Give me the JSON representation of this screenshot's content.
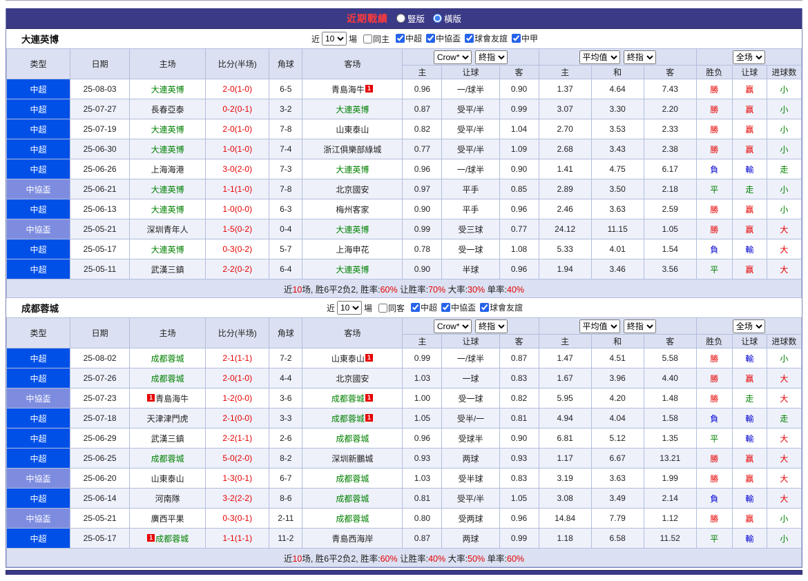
{
  "top_bar": {
    "title": "近期戰績",
    "radios": [
      {
        "label": "豎版",
        "selected": false
      },
      {
        "label": "橫版",
        "selected": true
      }
    ]
  },
  "badge_text": "1",
  "table": {
    "left_columns": [
      "类型",
      "日期",
      "主场",
      "比分(半场)",
      "角球",
      "客场"
    ],
    "odds_group": {
      "select1": "Crow*",
      "select2": "終指",
      "cols": [
        "主",
        "让球",
        "客"
      ]
    },
    "avg_group": {
      "select1": "平均值",
      "select2": "終指",
      "cols": [
        "主",
        "和",
        "客"
      ]
    },
    "result_group": {
      "select1": "全场",
      "cols": [
        "胜负",
        "让球",
        "进球数"
      ]
    }
  },
  "sections": [
    {
      "team": "大連英博",
      "filters": {
        "prefix": "近",
        "count": "10",
        "suffix": "場",
        "same_venue": {
          "label": "同主",
          "checked": false
        },
        "leagues": [
          {
            "label": "中超",
            "checked": true
          },
          {
            "label": "中協盃",
            "checked": true
          },
          {
            "label": "球會友誼",
            "checked": true
          },
          {
            "label": "中甲",
            "checked": true
          }
        ]
      },
      "rows": [
        {
          "league": "中超",
          "date": "25-08-03",
          "home": "大連英博",
          "home_green": true,
          "home_badge": "",
          "score": "2-0(1-0)",
          "corner": "6-5",
          "away": "青島海牛",
          "away_green": false,
          "away_badge": "post",
          "odds": [
            "0.96",
            "一/球半",
            "0.90"
          ],
          "avg": [
            "1.37",
            "4.64",
            "7.43"
          ],
          "results": [
            "勝",
            "赢",
            "小"
          ]
        },
        {
          "league": "中超",
          "date": "25-07-27",
          "home": "長春亞泰",
          "home_green": false,
          "home_badge": "",
          "score": "0-2(0-1)",
          "corner": "3-2",
          "away": "大連英博",
          "away_green": true,
          "away_badge": "",
          "odds": [
            "0.87",
            "受平/半",
            "0.99"
          ],
          "avg": [
            "3.07",
            "3.30",
            "2.20"
          ],
          "results": [
            "勝",
            "赢",
            "小"
          ]
        },
        {
          "league": "中超",
          "date": "25-07-19",
          "home": "大連英博",
          "home_green": true,
          "home_badge": "",
          "score": "2-0(1-0)",
          "corner": "7-8",
          "away": "山東泰山",
          "away_green": false,
          "away_badge": "",
          "odds": [
            "0.82",
            "受平/半",
            "1.04"
          ],
          "avg": [
            "2.70",
            "3.53",
            "2.33"
          ],
          "results": [
            "勝",
            "赢",
            "小"
          ]
        },
        {
          "league": "中超",
          "date": "25-06-30",
          "home": "大連英博",
          "home_green": true,
          "home_badge": "",
          "score": "1-0(1-0)",
          "corner": "7-4",
          "away": "浙江俱樂部綠城",
          "away_green": false,
          "away_badge": "",
          "odds": [
            "0.77",
            "受平/半",
            "1.09"
          ],
          "avg": [
            "2.68",
            "3.43",
            "2.38"
          ],
          "results": [
            "勝",
            "赢",
            "小"
          ]
        },
        {
          "league": "中超",
          "date": "25-06-26",
          "home": "上海海港",
          "home_green": false,
          "home_badge": "",
          "score": "3-0(2-0)",
          "corner": "7-3",
          "away": "大連英博",
          "away_green": true,
          "away_badge": "",
          "odds": [
            "0.96",
            "一/球半",
            "0.90"
          ],
          "avg": [
            "1.41",
            "4.75",
            "6.17"
          ],
          "results": [
            "負",
            "輸",
            "走"
          ]
        },
        {
          "league": "中協盃",
          "date": "25-06-21",
          "home": "大連英博",
          "home_green": true,
          "home_badge": "",
          "score": "1-1(1-0)",
          "corner": "7-8",
          "away": "北京國安",
          "away_green": false,
          "away_badge": "",
          "odds": [
            "0.97",
            "平手",
            "0.85"
          ],
          "avg": [
            "2.89",
            "3.50",
            "2.18"
          ],
          "results": [
            "平",
            "走",
            "小"
          ]
        },
        {
          "league": "中超",
          "date": "25-06-13",
          "home": "大連英博",
          "home_green": true,
          "home_badge": "",
          "score": "1-0(0-0)",
          "corner": "6-3",
          "away": "梅州客家",
          "away_green": false,
          "away_badge": "",
          "odds": [
            "0.90",
            "平手",
            "0.96"
          ],
          "avg": [
            "2.46",
            "3.63",
            "2.59"
          ],
          "results": [
            "勝",
            "赢",
            "小"
          ]
        },
        {
          "league": "中協盃",
          "date": "25-05-21",
          "home": "深圳青年人",
          "home_green": false,
          "home_badge": "",
          "score": "1-5(0-2)",
          "corner": "0-4",
          "away": "大連英博",
          "away_green": true,
          "away_badge": "",
          "odds": [
            "0.99",
            "受三球",
            "0.77"
          ],
          "avg": [
            "24.12",
            "11.15",
            "1.05"
          ],
          "results": [
            "勝",
            "赢",
            "大"
          ]
        },
        {
          "league": "中超",
          "date": "25-05-17",
          "home": "大連英博",
          "home_green": true,
          "home_badge": "",
          "score": "0-3(0-2)",
          "corner": "5-7",
          "away": "上海申花",
          "away_green": false,
          "away_badge": "",
          "odds": [
            "0.78",
            "受一球",
            "1.08"
          ],
          "avg": [
            "5.33",
            "4.01",
            "1.54"
          ],
          "results": [
            "負",
            "輸",
            "大"
          ]
        },
        {
          "league": "中超",
          "date": "25-05-11",
          "home": "武漢三鎮",
          "home_green": false,
          "home_badge": "",
          "score": "2-2(0-2)",
          "corner": "6-4",
          "away": "大連英博",
          "away_green": true,
          "away_badge": "",
          "odds": [
            "0.90",
            "半球",
            "0.96"
          ],
          "avg": [
            "1.94",
            "3.46",
            "3.56"
          ],
          "results": [
            "平",
            "赢",
            "大"
          ]
        }
      ],
      "summary": [
        {
          "text": "近"
        },
        {
          "text": "10",
          "red": true
        },
        {
          "text": "场, 胜6平2负2, 胜率:"
        },
        {
          "text": "60%",
          "red": true
        },
        {
          "text": " 让胜率:"
        },
        {
          "text": "70%",
          "red": true
        },
        {
          "text": " 大率:"
        },
        {
          "text": "30%",
          "red": true
        },
        {
          "text": " 单率:"
        },
        {
          "text": "40%",
          "red": true
        }
      ]
    },
    {
      "team": "成都蓉城",
      "filters": {
        "prefix": "近",
        "count": "10",
        "suffix": "場",
        "same_venue": {
          "label": "同客",
          "checked": false
        },
        "leagues": [
          {
            "label": "中超",
            "checked": true
          },
          {
            "label": "中協盃",
            "checked": true
          },
          {
            "label": "球會友誼",
            "checked": true
          }
        ]
      },
      "rows": [
        {
          "league": "中超",
          "date": "25-08-02",
          "home": "成都蓉城",
          "home_green": true,
          "home_badge": "",
          "score": "2-1(1-1)",
          "corner": "7-2",
          "away": "山東泰山",
          "away_green": false,
          "away_badge": "post",
          "odds": [
            "0.99",
            "一/球半",
            "0.87"
          ],
          "avg": [
            "1.47",
            "4.51",
            "5.58"
          ],
          "results": [
            "勝",
            "輸",
            "小"
          ]
        },
        {
          "league": "中超",
          "date": "25-07-26",
          "home": "成都蓉城",
          "home_green": true,
          "home_badge": "",
          "score": "2-0(1-0)",
          "corner": "4-4",
          "away": "北京國安",
          "away_green": false,
          "away_badge": "",
          "odds": [
            "1.03",
            "一球",
            "0.83"
          ],
          "avg": [
            "1.67",
            "3.96",
            "4.40"
          ],
          "results": [
            "勝",
            "赢",
            "大"
          ]
        },
        {
          "league": "中協盃",
          "date": "25-07-23",
          "home": "青島海牛",
          "home_green": false,
          "home_badge": "pre",
          "score": "1-2(0-0)",
          "corner": "3-6",
          "away": "成都蓉城",
          "away_green": true,
          "away_badge": "post",
          "odds": [
            "1.00",
            "受一球",
            "0.82"
          ],
          "avg": [
            "5.95",
            "4.20",
            "1.48"
          ],
          "results": [
            "勝",
            "走",
            "大"
          ]
        },
        {
          "league": "中超",
          "date": "25-07-18",
          "home": "天津津門虎",
          "home_green": false,
          "home_badge": "",
          "score": "2-1(0-0)",
          "corner": "3-3",
          "away": "成都蓉城",
          "away_green": true,
          "away_badge": "post",
          "odds": [
            "1.05",
            "受半/一",
            "0.81"
          ],
          "avg": [
            "4.94",
            "4.04",
            "1.58"
          ],
          "results": [
            "負",
            "輸",
            "走"
          ]
        },
        {
          "league": "中超",
          "date": "25-06-29",
          "home": "武漢三鎮",
          "home_green": false,
          "home_badge": "",
          "score": "2-2(1-1)",
          "corner": "2-6",
          "away": "成都蓉城",
          "away_green": true,
          "away_badge": "",
          "odds": [
            "0.96",
            "受球半",
            "0.90"
          ],
          "avg": [
            "6.81",
            "5.12",
            "1.35"
          ],
          "results": [
            "平",
            "輸",
            "大"
          ]
        },
        {
          "league": "中超",
          "date": "25-06-25",
          "home": "成都蓉城",
          "home_green": true,
          "home_badge": "",
          "score": "5-0(2-0)",
          "corner": "8-2",
          "away": "深圳新鵬城",
          "away_green": false,
          "away_badge": "",
          "odds": [
            "0.93",
            "两球",
            "0.93"
          ],
          "avg": [
            "1.17",
            "6.67",
            "13.21"
          ],
          "results": [
            "勝",
            "赢",
            "大"
          ]
        },
        {
          "league": "中協盃",
          "date": "25-06-20",
          "home": "山東泰山",
          "home_green": false,
          "home_badge": "",
          "score": "1-3(0-1)",
          "corner": "6-7",
          "away": "成都蓉城",
          "away_green": true,
          "away_badge": "",
          "odds": [
            "1.03",
            "受半球",
            "0.83"
          ],
          "avg": [
            "3.19",
            "3.63",
            "1.99"
          ],
          "results": [
            "勝",
            "赢",
            "大"
          ]
        },
        {
          "league": "中超",
          "date": "25-06-14",
          "home": "河南隊",
          "home_green": false,
          "home_badge": "",
          "score": "3-2(2-2)",
          "corner": "8-6",
          "away": "成都蓉城",
          "away_green": true,
          "away_badge": "",
          "odds": [
            "0.81",
            "受平/半",
            "1.05"
          ],
          "avg": [
            "3.08",
            "3.49",
            "2.14"
          ],
          "results": [
            "負",
            "輸",
            "大"
          ]
        },
        {
          "league": "中協盃",
          "date": "25-05-21",
          "home": "廣西平果",
          "home_green": false,
          "home_badge": "",
          "score": "0-3(0-1)",
          "corner": "2-11",
          "away": "成都蓉城",
          "away_green": true,
          "away_badge": "",
          "odds": [
            "0.80",
            "受两球",
            "0.96"
          ],
          "avg": [
            "14.84",
            "7.79",
            "1.12"
          ],
          "results": [
            "勝",
            "赢",
            "小"
          ]
        },
        {
          "league": "中超",
          "date": "25-05-17",
          "home": "成都蓉城",
          "home_green": true,
          "home_badge": "pre",
          "score": "1-1(1-1)",
          "corner": "11-2",
          "away": "青島西海岸",
          "away_green": false,
          "away_badge": "",
          "odds": [
            "0.87",
            "两球",
            "0.99"
          ],
          "avg": [
            "1.18",
            "6.58",
            "11.52"
          ],
          "results": [
            "平",
            "輸",
            "小"
          ]
        }
      ],
      "summary": [
        {
          "text": "近"
        },
        {
          "text": "10",
          "red": true
        },
        {
          "text": "场, 胜6平2负2, 胜率:"
        },
        {
          "text": "60%",
          "red": true
        },
        {
          "text": " 让胜率:"
        },
        {
          "text": "40%",
          "red": true
        },
        {
          "text": " 大率:"
        },
        {
          "text": "50%",
          "red": true
        },
        {
          "text": " 单率:"
        },
        {
          "text": "60%",
          "red": true
        }
      ]
    }
  ]
}
